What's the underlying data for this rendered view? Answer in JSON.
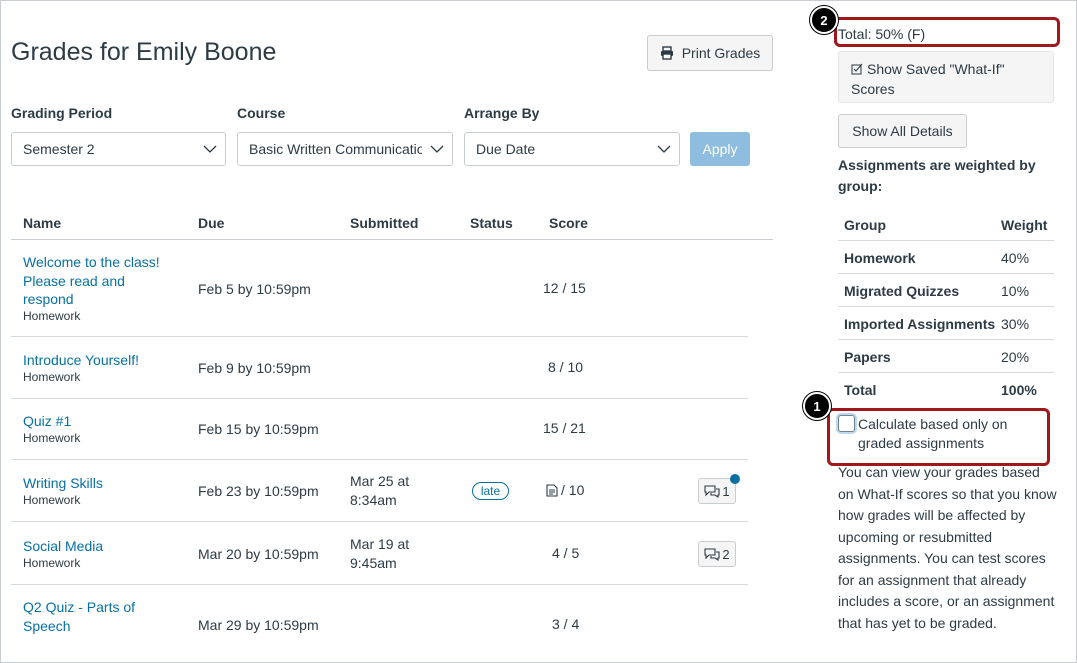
{
  "page": {
    "title": "Grades for Emily Boone",
    "print_label": "Print Grades"
  },
  "filters": {
    "grading_period": {
      "label": "Grading Period",
      "value": "Semester 2"
    },
    "course": {
      "label": "Course",
      "value": "Basic Written Communication"
    },
    "arrange_by": {
      "label": "Arrange By",
      "value": "Due Date"
    },
    "apply_label": "Apply"
  },
  "table": {
    "headers": {
      "name": "Name",
      "due": "Due",
      "submitted": "Submitted",
      "status": "Status",
      "score": "Score"
    },
    "rows": [
      {
        "name_lines": [
          "Welcome to the class!",
          "Please read and",
          "respond"
        ],
        "group": "Homework",
        "due": "Feb 5 by 10:59pm",
        "submitted": [],
        "status": "",
        "score": "12 / 15",
        "comments": ""
      },
      {
        "name_lines": [
          "Introduce Yourself!"
        ],
        "group": "Homework",
        "due": "Feb 9 by 10:59pm",
        "submitted": [],
        "status": "",
        "score": "8 / 10",
        "comments": ""
      },
      {
        "name_lines": [
          "Quiz #1"
        ],
        "group": "Homework",
        "due": "Feb 15 by 10:59pm",
        "submitted": [],
        "status": "",
        "score": "15 / 21",
        "comments": ""
      },
      {
        "name_lines": [
          "Writing Skills"
        ],
        "group": "Homework",
        "due": "Feb 23 by 10:59pm",
        "submitted": [
          "Mar 25 at",
          "8:34am"
        ],
        "status": "late",
        "score": "/ 10",
        "comments": "1"
      },
      {
        "name_lines": [
          "Social Media"
        ],
        "group": "Homework",
        "due": "Mar 20 by 10:59pm",
        "submitted": [
          "Mar 19 at",
          "9:45am"
        ],
        "status": "",
        "score": "4 / 5",
        "comments": "2"
      },
      {
        "name_lines": [
          "Q2 Quiz - Parts of",
          "Speech"
        ],
        "group": "",
        "due": "Mar 29 by 10:59pm",
        "submitted": [],
        "status": "",
        "score": "3 / 4",
        "comments": ""
      }
    ]
  },
  "sidebar": {
    "total": "Total: 50% (F)",
    "whatif_label": "Show Saved \"What-If\" Scores",
    "details_label": "Show All Details",
    "weighted_heading": "Assignments are weighted by group:",
    "weights": {
      "headers": {
        "group": "Group",
        "weight": "Weight"
      },
      "rows": [
        {
          "group": "Homework",
          "weight": "40%"
        },
        {
          "group": "Migrated Quizzes",
          "weight": "10%"
        },
        {
          "group": "Imported Assignments",
          "weight": "30%"
        },
        {
          "group": "Papers",
          "weight": "20%"
        },
        {
          "group": "Total",
          "weight": "100%"
        }
      ]
    },
    "calc_label": "Calculate based only on graded assignments",
    "info": "You can view your grades based on What-If scores so that you know how grades will be affected by upcoming or resubmitted assignments. You can test scores for an assignment that already includes a score, or an assignment that has yet to be graded."
  },
  "callouts": {
    "one": "1",
    "two": "2"
  },
  "colors": {
    "link": "#0770a3",
    "callout": "#a0171c",
    "apply": "#8ebde0"
  }
}
